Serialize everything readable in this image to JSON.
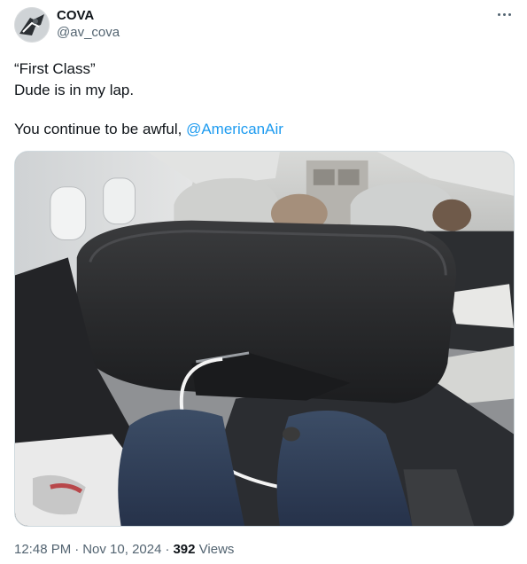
{
  "author": {
    "display_name": "COVA",
    "handle": "@av_cova",
    "avatar_icon": "profile-avatar"
  },
  "more_icon": "more-horizontal-icon",
  "tweet": {
    "line1": "“First Class”",
    "line2": "Dude is in my lap.",
    "line3_prefix": "You continue to be awful, ",
    "mention": "@AmericanAir"
  },
  "media": {
    "type": "photo",
    "alt": "Photo"
  },
  "meta": {
    "time": "12:48 PM",
    "date": "Nov 10, 2024",
    "views_count": "392",
    "views_label": "Views",
    "separator": "·"
  },
  "colors": {
    "link": "#1d9bf0",
    "secondary_text": "#536471",
    "primary_text": "#0f1419"
  }
}
